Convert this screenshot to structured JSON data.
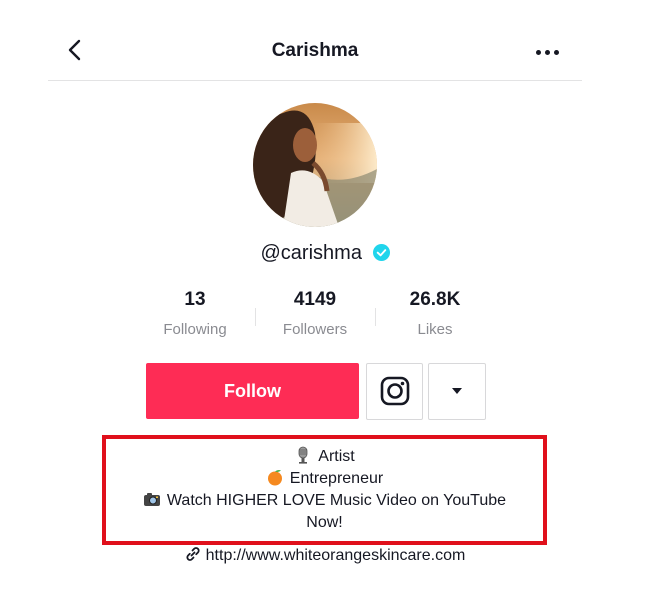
{
  "header": {
    "title": "Carishma",
    "back_icon": "chevron-left-icon",
    "more_icon": "more-dots-icon"
  },
  "profile": {
    "handle": "@carishma",
    "verified": true,
    "verified_color": "#20d5ec",
    "avatar_icon": "profile-photo"
  },
  "stats": [
    {
      "value": "13",
      "label": "Following"
    },
    {
      "value": "4149",
      "label": "Followers"
    },
    {
      "value": "26.8K",
      "label": "Likes"
    }
  ],
  "actions": {
    "follow_label": "Follow",
    "follow_color": "#fe2c55",
    "instagram_icon": "instagram-icon",
    "dropdown_icon": "caret-down-icon"
  },
  "bio": {
    "highlight_color": "#e0101b",
    "lines": [
      {
        "icon": "microphone-icon",
        "text": "Artist"
      },
      {
        "icon": "orange-icon",
        "text": "Entrepreneur"
      },
      {
        "icon": "camera-icon",
        "text": "Watch HIGHER LOVE Music Video on YouTube"
      },
      {
        "icon": "",
        "text": "Now!"
      }
    ]
  },
  "link": {
    "icon": "link-icon",
    "url": "http://www.whiteorangeskincare.com"
  }
}
